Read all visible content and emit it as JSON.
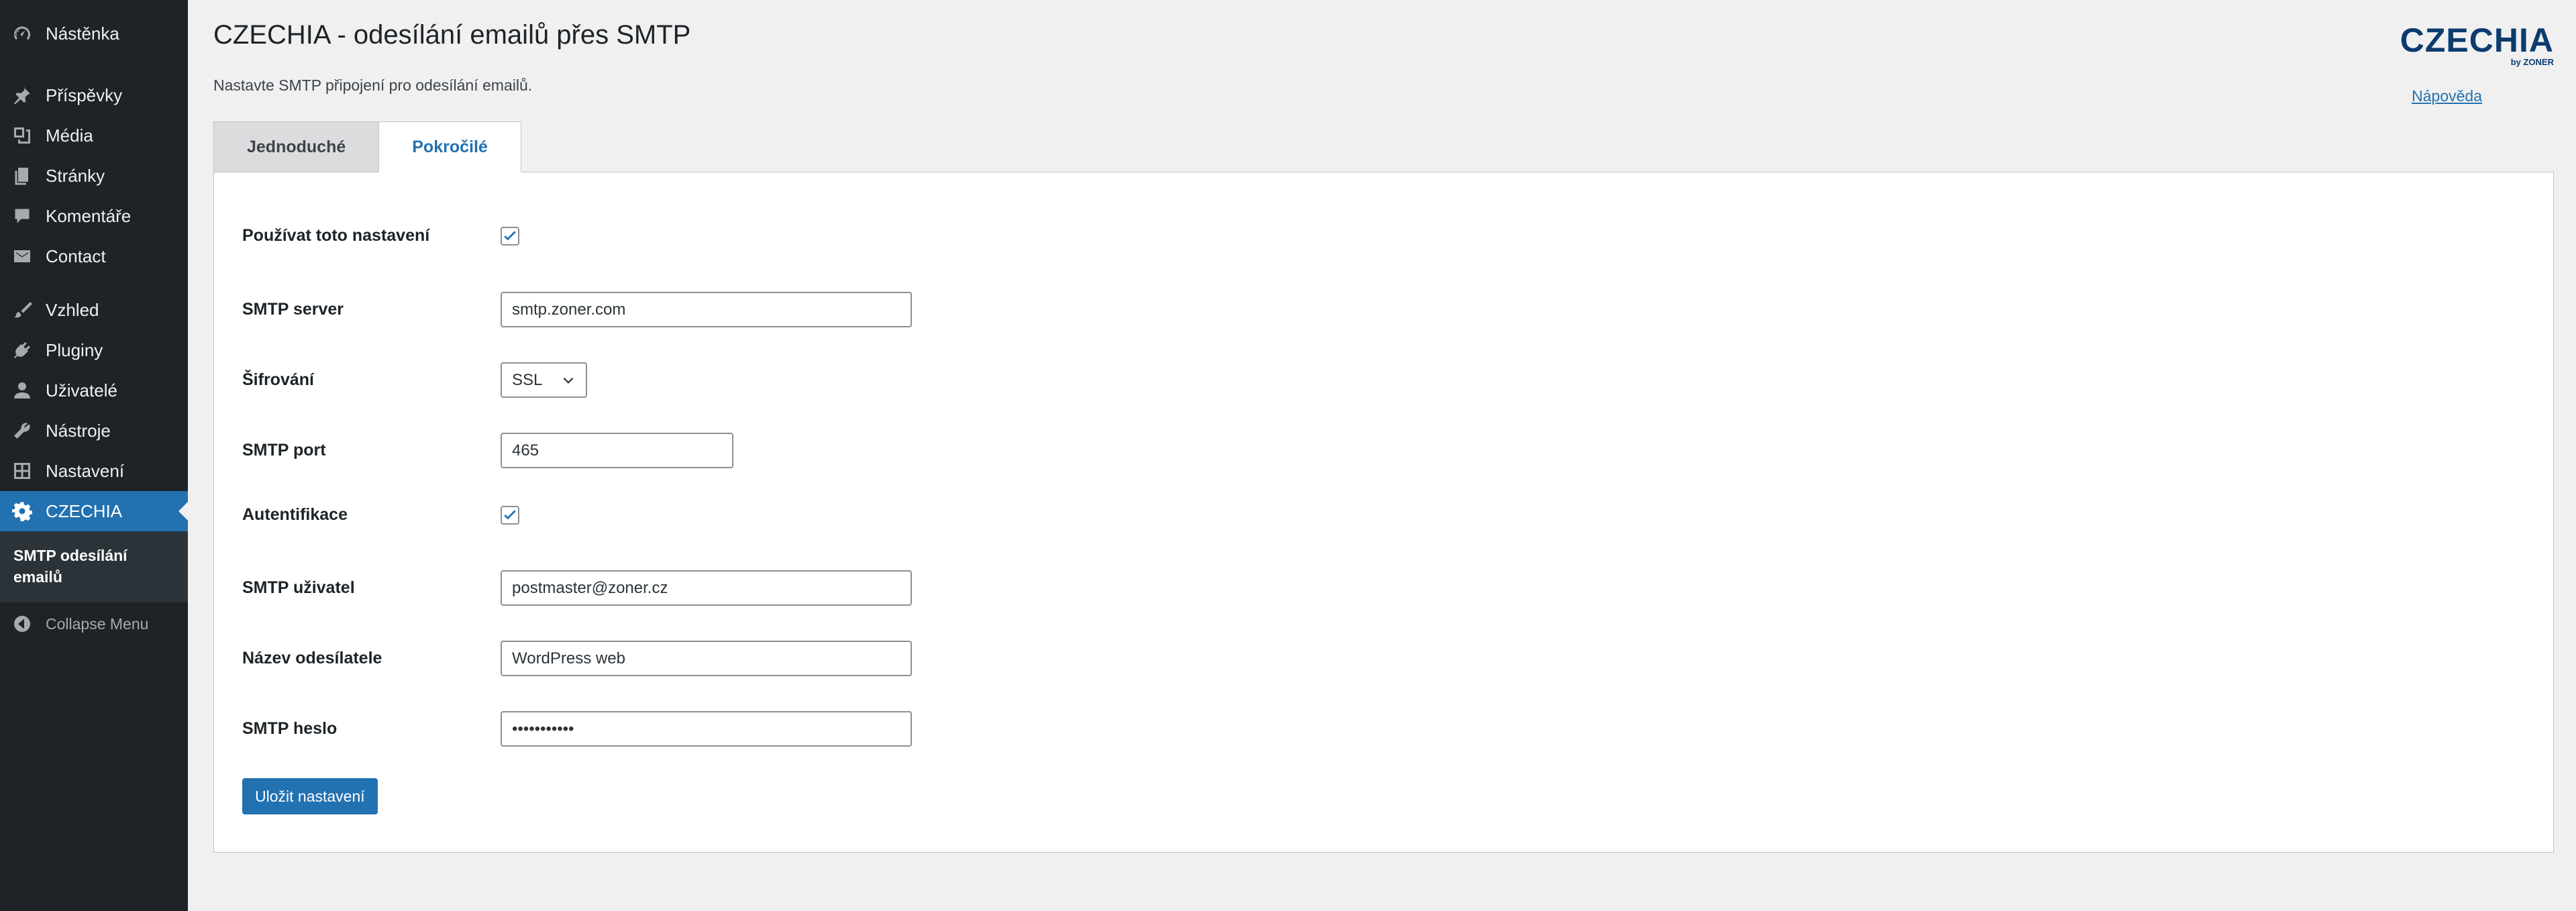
{
  "sidebar": {
    "items": [
      {
        "label": "Nástěnka",
        "icon": "dashboard-icon"
      },
      {
        "label": "Příspěvky",
        "icon": "pin-icon"
      },
      {
        "label": "Média",
        "icon": "media-icon"
      },
      {
        "label": "Stránky",
        "icon": "pages-icon"
      },
      {
        "label": "Komentáře",
        "icon": "comment-icon"
      },
      {
        "label": "Contact",
        "icon": "email-icon"
      },
      {
        "label": "Vzhled",
        "icon": "brush-icon"
      },
      {
        "label": "Pluginy",
        "icon": "plugin-icon"
      },
      {
        "label": "Uživatelé",
        "icon": "user-icon"
      },
      {
        "label": "Nástroje",
        "icon": "wrench-icon"
      },
      {
        "label": "Nastavení",
        "icon": "settings-grid-icon"
      },
      {
        "label": "CZECHIA",
        "icon": "gear-icon"
      }
    ],
    "submenu": {
      "label": "SMTP odesílání emailů"
    },
    "collapse": {
      "label": "Collapse Menu",
      "icon": "collapse-arrow-icon"
    }
  },
  "header": {
    "title": "CZECHIA - odesílání emailů přes SMTP",
    "description": "Nastavte SMTP připojení pro odesílání emailů.",
    "help_link": "Nápověda",
    "brand": {
      "name": "CZECHIA",
      "sub": "by ZONER",
      "color": "#0c3c6e"
    }
  },
  "tabs": [
    {
      "label": "Jednoduché"
    },
    {
      "label": "Pokročilé"
    }
  ],
  "form": {
    "use_settings": {
      "label": "Používat toto nastavení",
      "checked": true
    },
    "smtp_server": {
      "label": "SMTP server",
      "value": "smtp.zoner.com"
    },
    "encryption": {
      "label": "Šifrování",
      "value": "SSL"
    },
    "smtp_port": {
      "label": "SMTP port",
      "value": "465"
    },
    "authentication": {
      "label": "Autentifikace",
      "checked": true
    },
    "smtp_user": {
      "label": "SMTP uživatel",
      "value": "postmaster@zoner.cz"
    },
    "sender_name": {
      "label": "Název odesílatele",
      "value": "WordPress web"
    },
    "smtp_password": {
      "label": "SMTP heslo",
      "value": "•••••••••••"
    },
    "save_label": "Uložit nastavení"
  },
  "colors": {
    "accent": "#2271b1",
    "sidebar": "#1d2327"
  }
}
